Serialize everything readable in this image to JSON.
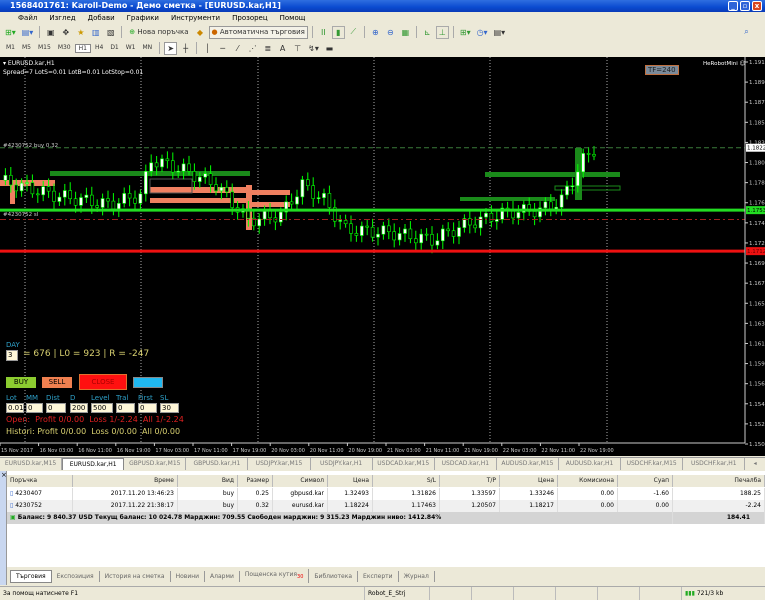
{
  "window": {
    "title": "1568401761: Karoll-Demo - Демо сметка - [EURUSD.kar,H1]"
  },
  "menu": [
    "Файл",
    "Изглед",
    "Добави",
    "Графики",
    "Инструменти",
    "Прозорец",
    "Помощ"
  ],
  "toolbar": {
    "new_order": "Нова поръчка",
    "auto_trading": "Автоматична търговия",
    "timeframes": [
      "M1",
      "M5",
      "M15",
      "M30",
      "H1",
      "H4",
      "D1",
      "W1",
      "MN"
    ],
    "active_timeframe": "H1",
    "text_tool": "A"
  },
  "chart": {
    "symbol_label": "EURUSD.kar,H1",
    "info_line": "Spread=7  LotS=0.01  LotB=0.01  LotStop=0.01",
    "expert_name": "HeRobotMini",
    "tf_badge": "TF=240",
    "order_label": "#4230752 buy 0.32",
    "sl_label": "#4230752 sl",
    "price_labels": [
      "1.1912",
      "1.1890",
      "1.1874",
      "1.1852",
      "1.1830",
      "1.1808",
      "1.1786",
      "1.1764",
      "1.1743",
      "1.1721",
      "1.1699",
      "1.1677",
      "1.1655",
      "1.1633",
      "1.1612",
      "1.1590",
      "1.1568",
      "1.1546",
      "1.1524",
      "1.1502"
    ],
    "price_top": 1.1912,
    "price_bottom": 1.1502,
    "current_price": "1.1822",
    "green_level": "1.1753",
    "red_level": "1.1712",
    "order_price": 1.182,
    "green_price": 1.1753,
    "sl_price": 1.1743,
    "red_price": 1.1709,
    "time_labels": [
      "15 Nov 2017",
      "16 Nov 03:00",
      "16 Nov 11:00",
      "16 Nov 19:00",
      "17 Nov 03:00",
      "17 Nov 11:00",
      "17 Nov 19:00",
      "20 Nov 03:00",
      "20 Nov 11:00",
      "20 Nov 19:00",
      "21 Nov 03:00",
      "21 Nov 11:00",
      "21 Nov 19:00",
      "22 Nov 03:00",
      "22 Nov 11:00",
      "22 Nov 19:00"
    ],
    "price_anchors": [
      [
        0,
        1.1785
      ],
      [
        10,
        1.1769
      ],
      [
        20,
        1.1759
      ],
      [
        26,
        1.1769
      ],
      [
        28,
        1.1807
      ],
      [
        34,
        1.1796
      ],
      [
        40,
        1.178
      ],
      [
        46,
        1.1742
      ],
      [
        52,
        1.1748
      ],
      [
        56,
        1.178
      ],
      [
        60,
        1.1764
      ],
      [
        64,
        1.1732
      ],
      [
        72,
        1.1729
      ],
      [
        80,
        1.1721
      ],
      [
        86,
        1.1737
      ],
      [
        94,
        1.1751
      ],
      [
        100,
        1.1753
      ],
      [
        104,
        1.1764
      ],
      [
        108,
        1.1807
      ],
      [
        110,
        1.1818
      ]
    ],
    "colors": {
      "bull": "#ffffff",
      "bear": "#000000",
      "candle_outline": "#00ff00",
      "green_line": "#22dd22",
      "red_line": "#ee1111",
      "zone_orange": "#f08060",
      "zone_green": "#1a8a1a"
    }
  },
  "panel": {
    "day_label": "DAY",
    "day_value": "3",
    "stats": "= 676 | L0 = 923 | R = -247",
    "buy": "BUY",
    "sell": "SELL",
    "close": "CLOSE",
    "fields": [
      {
        "label": "Lot",
        "value": "0.01"
      },
      {
        "label": "MM",
        "value": "0"
      },
      {
        "label": "Dist",
        "value": "0"
      },
      {
        "label": "D",
        "value": "200"
      },
      {
        "label": "Level",
        "value": "500"
      },
      {
        "label": "Tral",
        "value": "0"
      },
      {
        "label": "First",
        "value": "0"
      },
      {
        "label": "SL",
        "value": "30"
      }
    ],
    "open_line": "Open:  Profit 0/0.00  Loss 1/-2.24  All 1/-2.24",
    "history_line": "Histori: Profit 0/0.00  Loss 0/0.00  All 0/0.00"
  },
  "chart_tabs": [
    "EURUSD.kar,M15",
    "EURUSD.kar,H1",
    "GBPUSD.kar,M15",
    "GBPUSD.kar,H1",
    "USDJPY.kar,M15",
    "USDJPY.kar,H1",
    "USDCAD.kar,M15",
    "USDCAD.kar,H1",
    "AUDUSD.kar,M15",
    "AUDUSD.kar,H1",
    "USDCHF.kar,M15",
    "USDCHF.kar,H1"
  ],
  "active_chart_tab": 1,
  "orders": {
    "columns": [
      "Поръчка",
      "Време",
      "Вид",
      "Размер",
      "Символ",
      "Цена",
      "S/L",
      "T/P",
      "Цена",
      "Комисиона",
      "Суап",
      "Печалба"
    ],
    "rows": [
      [
        "4230407",
        "2017.11.20 13:46:23",
        "buy",
        "0.25",
        "gbpusd.kar",
        "1.32493",
        "1.31826",
        "1.33597",
        "1.33246",
        "0.00",
        "-1.60",
        "188.25"
      ],
      [
        "4230752",
        "2017.11.22 21:38:17",
        "buy",
        "0.32",
        "eurusd.kar",
        "1.18224",
        "1.17463",
        "1.20507",
        "1.18217",
        "0.00",
        "0.00",
        "-2.24"
      ]
    ],
    "summary": "Баланс: 9 840.37 USD  Текущ баланс: 10 024.78  Марджин: 709.55  Свободен марджин: 9 315.23  Марджин ниво: 1412.84%",
    "summary_total": "184.41"
  },
  "terminal_tabs": [
    "Търговия",
    "Експозиция",
    "История на сметка",
    "Новини",
    "Аларми",
    "Пощенска кутия",
    "Библиотека",
    "Експерти",
    "Журнал"
  ],
  "mailbox_badge": "30",
  "status": {
    "help": "За помощ натиснете F1",
    "profile": "Robot_E_Strj",
    "traffic": "721/3 kb"
  }
}
